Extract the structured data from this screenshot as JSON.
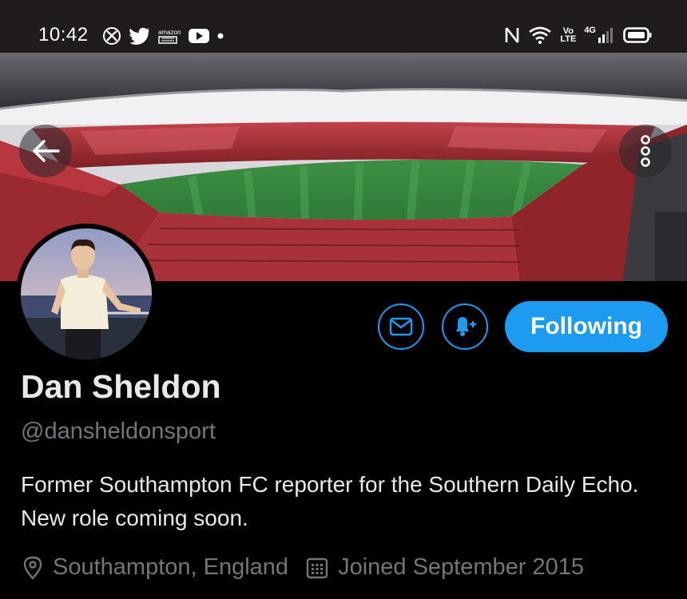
{
  "status_bar": {
    "time": "10:42",
    "left_icons": [
      "xbox-icon",
      "twitter-icon",
      "amazon-icon",
      "youtube-icon",
      "dot-icon"
    ],
    "amazon_text": "amazon",
    "right_icons": [
      "nfc-icon",
      "wifi-icon",
      "volte-icon",
      "signal-icon",
      "battery-icon"
    ],
    "volte_text": "Vo LTE",
    "network_text": "4G"
  },
  "header": {
    "back_icon": "arrow-left-icon",
    "more_icon": "more-vertical-icon"
  },
  "actions": {
    "message_icon": "envelope-icon",
    "notify_icon": "bell-plus-icon",
    "following_label": "Following"
  },
  "profile": {
    "display_name": "Dan Sheldon",
    "handle": "@dansheldonsport",
    "bio": "Former Southampton FC reporter for the Southern Daily Echo. New role coming soon.",
    "location": "Southampton, England",
    "joined": "Joined September 2015",
    "location_icon": "location-pin-icon",
    "joined_icon": "calendar-icon"
  },
  "colors": {
    "accent": "#1d9bf0",
    "background": "#000000",
    "secondary_text": "#71767b",
    "primary_text": "#e7e9ea"
  }
}
